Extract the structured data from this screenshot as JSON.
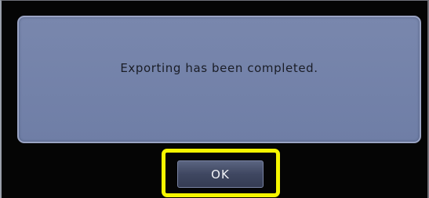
{
  "dialog": {
    "message": "Exporting has been completed.",
    "ok_label": "OK"
  },
  "colors": {
    "background": "#050505",
    "panel": "#7483aa",
    "highlight": "#f6f600",
    "button": "#3f4761"
  }
}
